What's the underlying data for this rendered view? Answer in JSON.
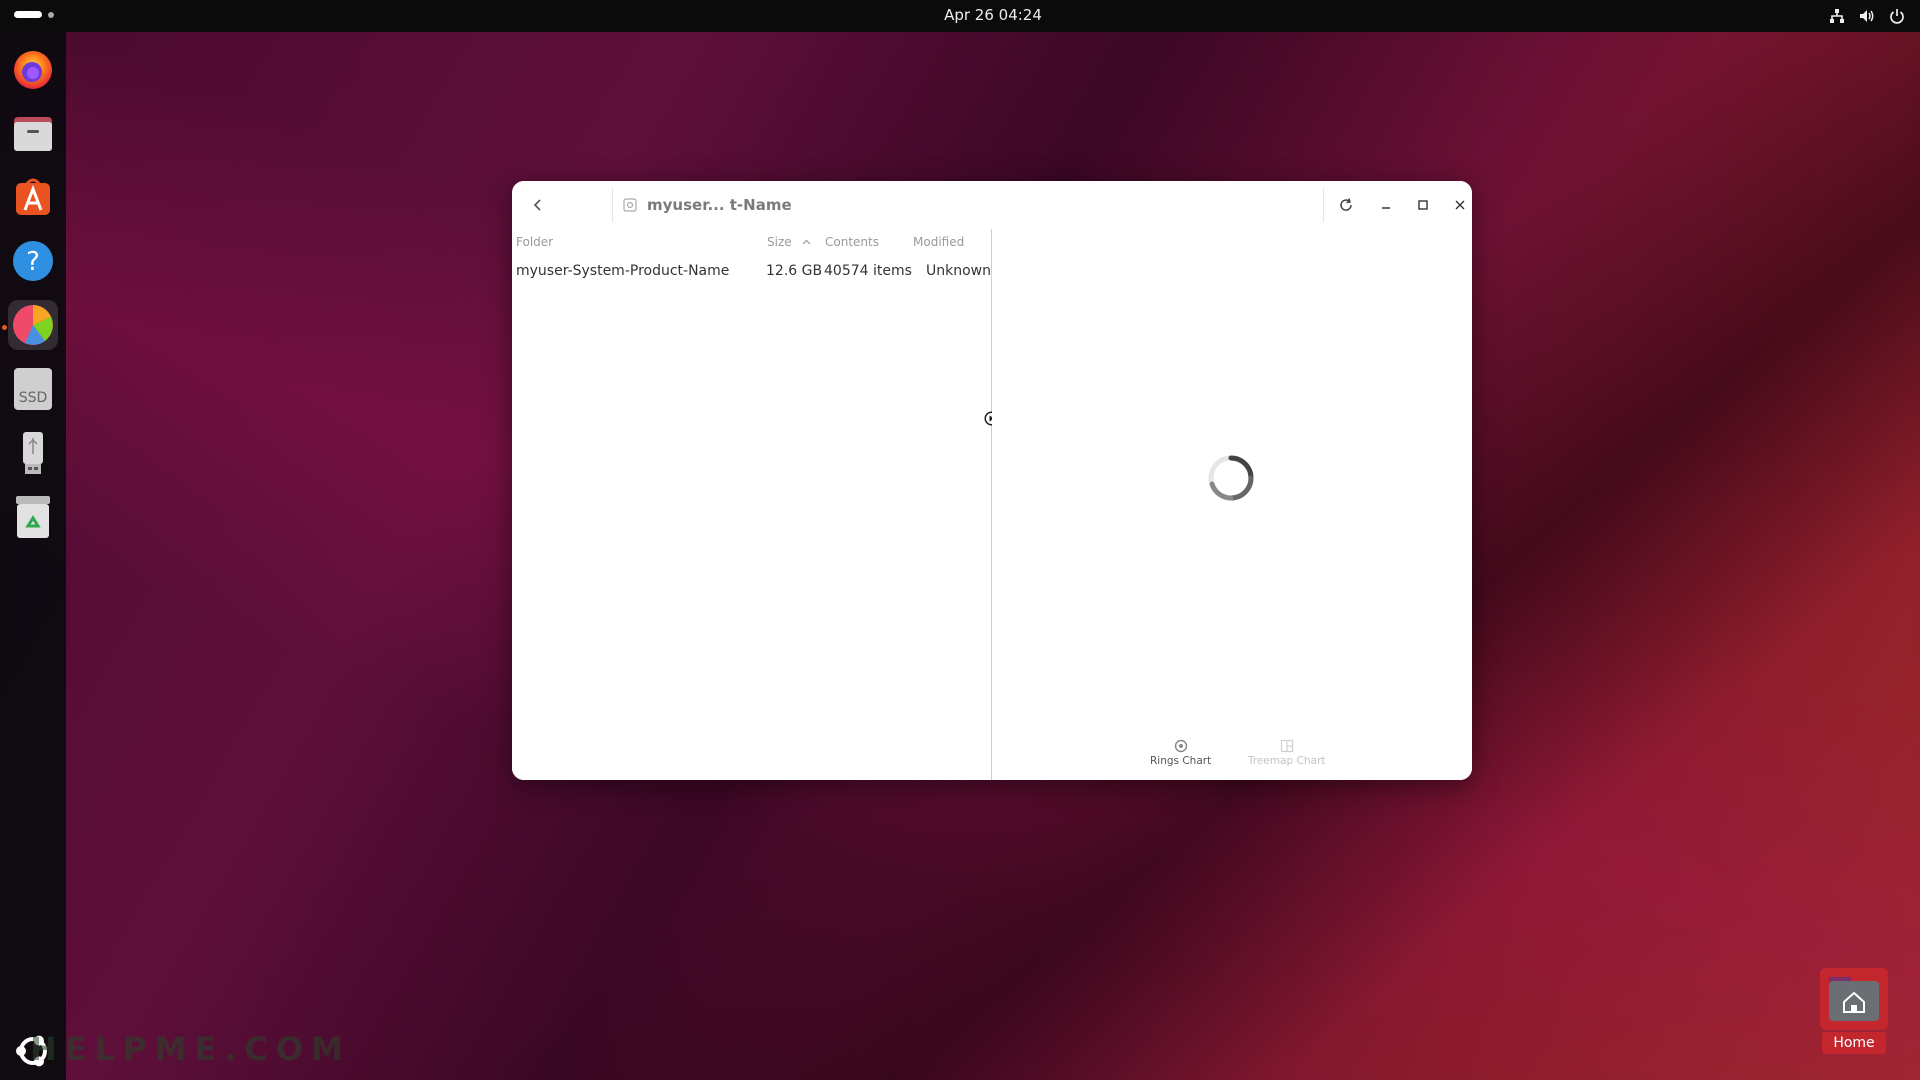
{
  "topbar": {
    "clock": "Apr 26  04:24",
    "tray_icons": [
      "network-icon",
      "volume-icon",
      "power-icon"
    ]
  },
  "dock": {
    "items": [
      {
        "name": "firefox",
        "icon": "firefox-icon"
      },
      {
        "name": "files",
        "icon": "files-icon"
      },
      {
        "name": "app-center",
        "icon": "app-center-icon"
      },
      {
        "name": "help",
        "icon": "help-icon"
      },
      {
        "name": "disk-usage-analyzer",
        "icon": "disk-usage-analyzer-icon",
        "active": true
      },
      {
        "name": "ssd-drive",
        "icon": "ssd-icon",
        "label": "SSD"
      },
      {
        "name": "usb-drive",
        "icon": "usb-drive-icon"
      },
      {
        "name": "trash",
        "icon": "trash-icon"
      }
    ],
    "show_apps_icon": "ubuntu-logo-icon"
  },
  "window": {
    "path_label": "myuser... t-Name",
    "columns": {
      "folder": "Folder",
      "size": "Size",
      "contents": "Contents",
      "modified": "Modified"
    },
    "rows": [
      {
        "folder": "myuser-System-Product-Name",
        "size": "12.6 GB",
        "contents": "40574 items",
        "modified": "Unknown"
      }
    ],
    "chart_switch": {
      "rings": "Rings Chart",
      "treemap": "Treemap Chart"
    }
  },
  "desktop": {
    "home_label": "Home"
  },
  "watermark": "HELPME.COM",
  "colors": {
    "topbar_bg": "#0b0b0b",
    "accent": "#e95420",
    "home_tile": "#c4262e"
  }
}
